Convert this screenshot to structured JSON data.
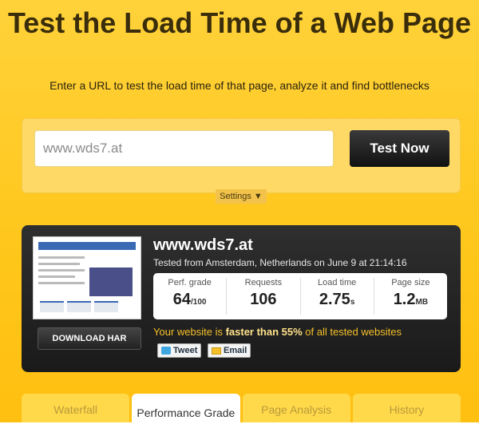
{
  "header": {
    "title": "Test the Load Time of a Web Page",
    "subtitle": "Enter a URL to test the load time of that page, analyze it and find bottlenecks"
  },
  "form": {
    "url_value": "www.wds7.at",
    "test_button": "Test Now",
    "settings_label": "Settings",
    "settings_arrow": "▼"
  },
  "result": {
    "site": "www.wds7.at",
    "tested_from": "Tested from Amsterdam, Netherlands on June 9 at 21:14:16",
    "download_button": "DOWNLOAD HAR",
    "stats": [
      {
        "label": "Perf. grade",
        "value": "64",
        "unit": "/100"
      },
      {
        "label": "Requests",
        "value": "106",
        "unit": ""
      },
      {
        "label": "Load time",
        "value": "2.75",
        "unit": "s"
      },
      {
        "label": "Page size",
        "value": "1.2",
        "unit": "MB"
      }
    ],
    "faster_prefix": "Your website is ",
    "faster_bold": "faster than 55%",
    "faster_suffix": " of all tested websites",
    "tweet_label": "Tweet",
    "email_label": "Email"
  },
  "tabs": [
    {
      "label": "Waterfall"
    },
    {
      "label": "Performance Grade"
    },
    {
      "label": "Page Analysis"
    },
    {
      "label": "History"
    }
  ]
}
